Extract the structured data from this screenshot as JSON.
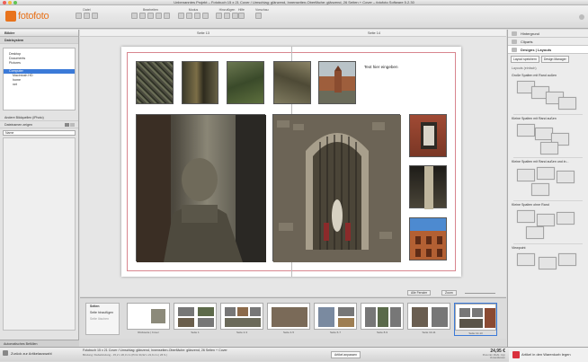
{
  "window": {
    "title": "Unbenanntes Projekt – Fotobuch 15 x 21 Cover / Umschlag: glänzend, Innenseiten-Oberfläche: glänzend, 26 Seiten + Cover – fotofoto Software 5.2.30"
  },
  "brand": {
    "logo_text": "fotofoto",
    "accent": "#e8731c"
  },
  "toolbar": {
    "groups": [
      {
        "label": "Datei"
      },
      {
        "label": "Bearbeiten"
      },
      {
        "label": "Modus"
      },
      {
        "label": "Hinzufügen"
      },
      {
        "label": "Hilfe"
      },
      {
        "label": "Vorschau"
      }
    ]
  },
  "left_panel": {
    "title": "Bilder",
    "section": "Dateisystem",
    "tree": [
      "Desktop",
      "Documents",
      "Pictures",
      "Computer",
      "Macintosh HD",
      "home",
      "net"
    ],
    "selected": "Computer",
    "lower": "Andere Bildquellen (iPhoto)",
    "search_label": "Dateinamen zeigen",
    "name_field": "Name",
    "bottom": "Automatisches Befüllen"
  },
  "canvas": {
    "left_page_label": "Seite 13",
    "right_page_label": "Seite 14",
    "text_placeholder": "Text hier eingeben"
  },
  "zoom_bar": {
    "fit_label": "Alle Fenster",
    "zoom_label": "Zoom"
  },
  "filmstrip": {
    "actions": [
      "Seiten",
      "Seite hinzufügen",
      "Seite löschen"
    ],
    "thumbs": [
      "Rückseite | Cover",
      "Seite 1",
      "Seite 2-3",
      "Seite 4-5",
      "Seite 6-7",
      "Seite 8-9",
      "Seite 10-11",
      "Seite 12-13",
      "Seite 14-15"
    ]
  },
  "right_panel": {
    "tabs": [
      "Hintergrund",
      "Cliparts",
      "Designs | Layouts"
    ],
    "buttons": [
      "Layout speichern",
      "Design Manager"
    ],
    "current": "Layouts (einfach)",
    "sections": [
      "Große Spalten mit Rand außen",
      "Kleine Spalten mit Rand außen",
      "Kleine Spalten mit Rand außen und in...",
      "Kleine Spalten ohne Rand",
      "Viewpoint"
    ]
  },
  "status": {
    "back": "Zurück zur Artikelauswahl",
    "product": "Fotobuch 15 x 21 Cover / Umschlag: glänzend, Innenseiten-Oberfläche: glänzend, 26 Seiten + Cover",
    "detail": "Bindung: Klebebindung - 15,2 x 20,3 cm (Print 34,92 x 21,9 cm | 26 S.)",
    "save": "Artikel anpassen",
    "price": "24,95 €",
    "price_note": "Preis inkl. MwSt. zzgl. Versandkosten",
    "cart": "Artikel in den Warenkorb legen"
  }
}
